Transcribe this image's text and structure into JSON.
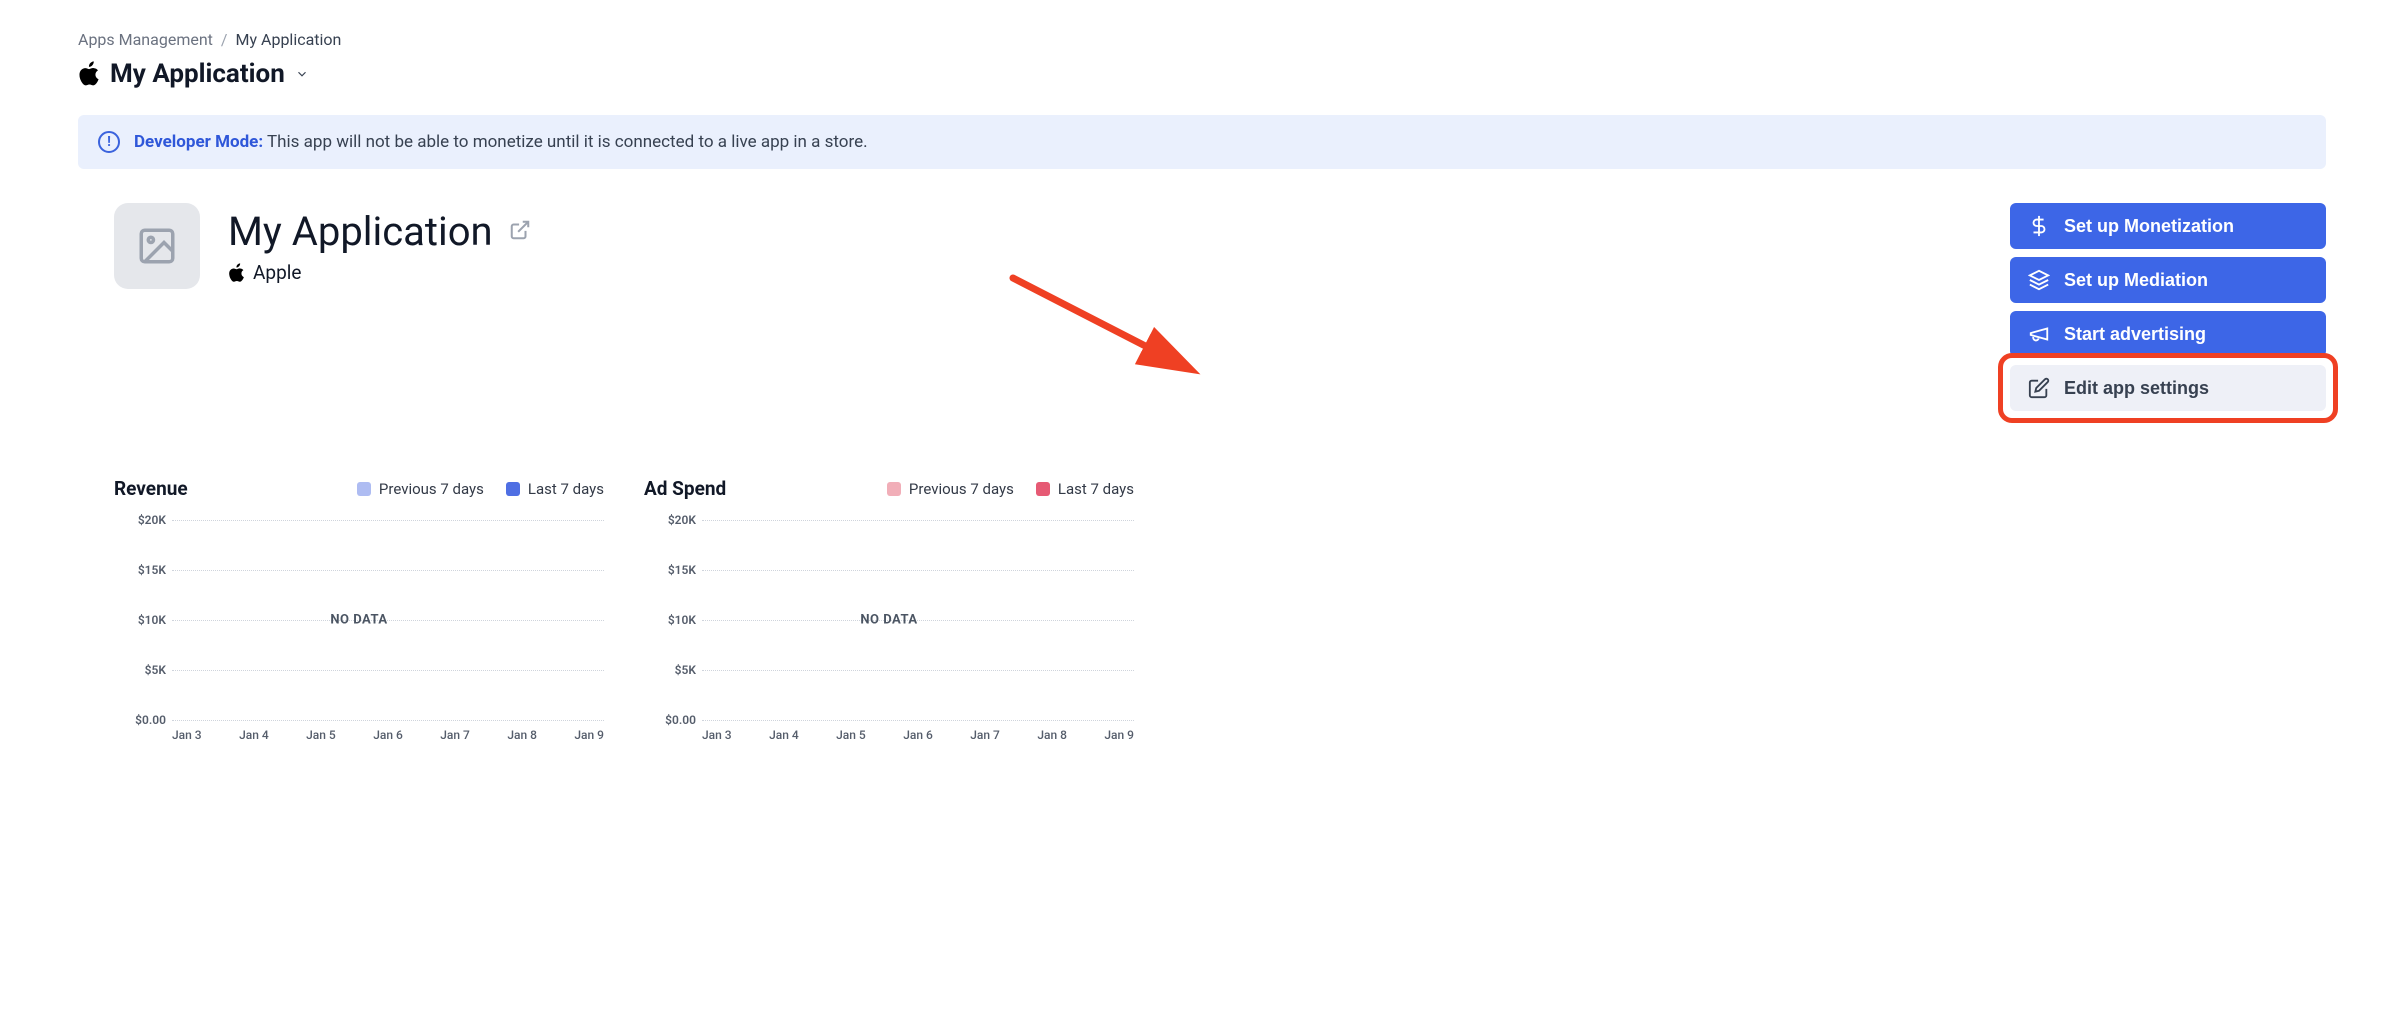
{
  "breadcrumb": {
    "parent": "Apps Management",
    "sep": "/",
    "current": "My Application"
  },
  "app_selector": {
    "name": "My Application"
  },
  "alert": {
    "title": "Developer Mode:",
    "message": "This app will not be able to monetize until it is connected to a live app in a store."
  },
  "app": {
    "name": "My Application",
    "platform": "Apple"
  },
  "actions": {
    "monetization": "Set up Monetization",
    "mediation": "Set up Mediation",
    "advertising": "Start advertising",
    "edit": "Edit app settings"
  },
  "charts": {
    "revenue": {
      "title": "Revenue",
      "legend_prev": "Previous 7 days",
      "legend_last": "Last 7 days",
      "color_prev": "#aebcf2",
      "color_last": "#4f6fe3",
      "no_data": "NO DATA"
    },
    "adspend": {
      "title": "Ad Spend",
      "legend_prev": "Previous 7 days",
      "legend_last": "Last 7 days",
      "color_prev": "#f1aeb8",
      "color_last": "#e65a74",
      "no_data": "NO DATA"
    },
    "y_ticks": [
      "$20K",
      "$15K",
      "$10K",
      "$5K",
      "$0.00"
    ],
    "x_ticks": [
      "Jan 3",
      "Jan 4",
      "Jan 5",
      "Jan 6",
      "Jan 7",
      "Jan 8",
      "Jan 9"
    ]
  },
  "chart_data": [
    {
      "type": "line",
      "title": "Revenue",
      "ylabel": "",
      "ylim": [
        0,
        20000
      ],
      "categories": [
        "Jan 3",
        "Jan 4",
        "Jan 5",
        "Jan 6",
        "Jan 7",
        "Jan 8",
        "Jan 9"
      ],
      "series": [
        {
          "name": "Previous 7 days",
          "values": [
            null,
            null,
            null,
            null,
            null,
            null,
            null
          ]
        },
        {
          "name": "Last 7 days",
          "values": [
            null,
            null,
            null,
            null,
            null,
            null,
            null
          ]
        }
      ],
      "note": "NO DATA"
    },
    {
      "type": "line",
      "title": "Ad Spend",
      "ylabel": "",
      "ylim": [
        0,
        20000
      ],
      "categories": [
        "Jan 3",
        "Jan 4",
        "Jan 5",
        "Jan 6",
        "Jan 7",
        "Jan 8",
        "Jan 9"
      ],
      "series": [
        {
          "name": "Previous 7 days",
          "values": [
            null,
            null,
            null,
            null,
            null,
            null,
            null
          ]
        },
        {
          "name": "Last 7 days",
          "values": [
            null,
            null,
            null,
            null,
            null,
            null,
            null
          ]
        }
      ],
      "note": "NO DATA"
    }
  ]
}
